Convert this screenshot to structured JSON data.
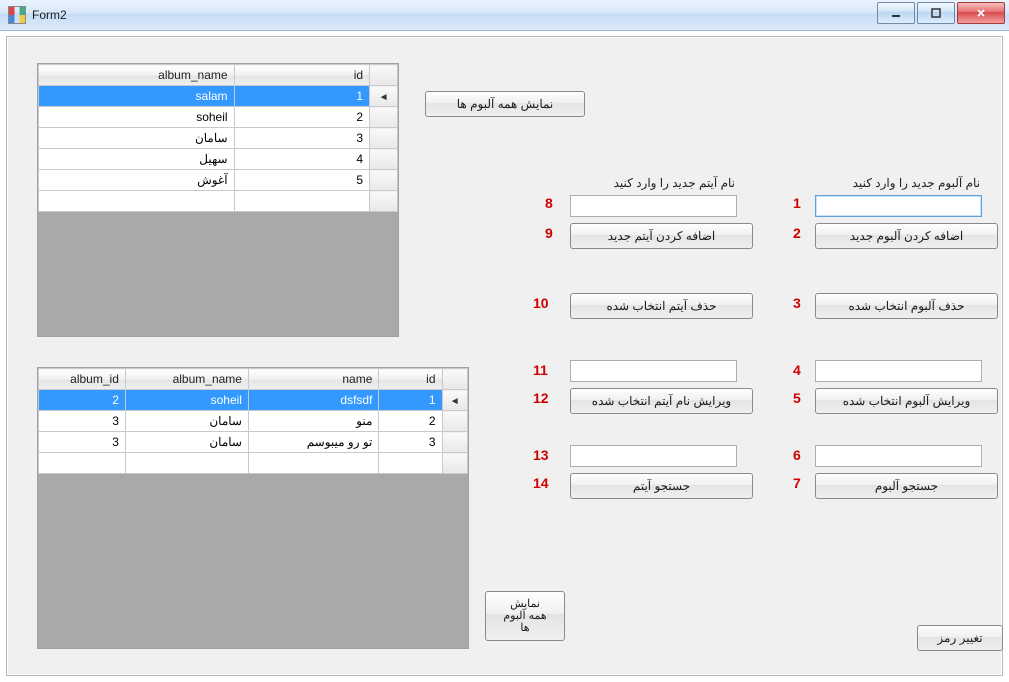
{
  "window": {
    "title": "Form2"
  },
  "grid1": {
    "columns": [
      "album_name",
      "id"
    ],
    "rows": [
      {
        "album_name": "salam",
        "id": "1",
        "selected": true
      },
      {
        "album_name": "soheil",
        "id": "2"
      },
      {
        "album_name": "سامان",
        "id": "3"
      },
      {
        "album_name": "سهیل",
        "id": "4"
      },
      {
        "album_name": "آغوش",
        "id": "5"
      }
    ]
  },
  "grid2": {
    "columns": [
      "album_id",
      "album_name",
      "name",
      "id"
    ],
    "rows": [
      {
        "album_id": "2",
        "album_name": "soheil",
        "name": "dsfsdf",
        "id": "1",
        "selected": true
      },
      {
        "album_id": "3",
        "album_name": "سامان",
        "name": "منو",
        "id": "2"
      },
      {
        "album_id": "3",
        "album_name": "سامان",
        "name": "تو رو میبوسم",
        "id": "3"
      }
    ]
  },
  "buttons": {
    "show_all_albums": "نمایش همه آلبوم ها",
    "show_all_albums_small": "نمایش\nهمه آلبوم\nها",
    "change_password": "تغییر رمز"
  },
  "album_panel": {
    "label_new": "نام آلبوم جدید را وارد کنید",
    "add": "اضافه کردن آلبوم جدید",
    "delete": "حذف آلبوم انتخاب شده",
    "edit": "ویرایش آلبوم انتخاب شده",
    "search": "جستجو آلبوم"
  },
  "item_panel": {
    "label_new": "نام آیتم جدید را وارد کنید",
    "add": "اضافه کردن آیتم جدید",
    "delete": "حذف آیتم انتخاب شده",
    "edit": "ویرایش نام آیتم انتخاب شده",
    "search": "جستجو آیتم"
  },
  "annotations": {
    "n1": "1",
    "n2": "2",
    "n3": "3",
    "n4": "4",
    "n5": "5",
    "n6": "6",
    "n7": "7",
    "n8": "8",
    "n9": "9",
    "n10": "10",
    "n11": "11",
    "n12": "12",
    "n13": "13",
    "n14": "14"
  }
}
